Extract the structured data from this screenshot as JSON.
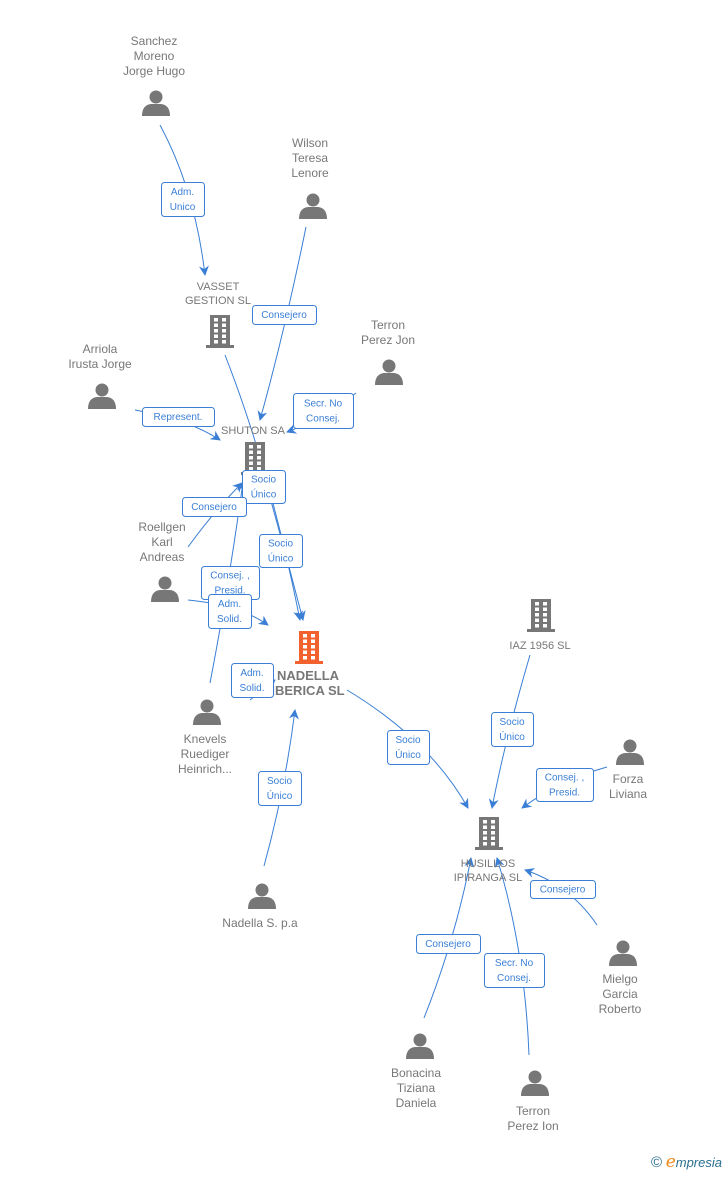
{
  "colors": {
    "edge": "#3a7fd5",
    "node": "#777777",
    "focus": "#f2622e"
  },
  "nodes": [
    {
      "id": "sanchez",
      "type": "person",
      "lines": [
        "Sanchez",
        "Moreno",
        "Jorge Hugo"
      ]
    },
    {
      "id": "wilson",
      "type": "person",
      "lines": [
        "Wilson",
        "Teresa",
        "Lenore"
      ]
    },
    {
      "id": "terronjon",
      "type": "person",
      "lines": [
        "Terron",
        "Perez Jon"
      ]
    },
    {
      "id": "arriola",
      "type": "person",
      "lines": [
        "Arriola",
        "Irusta Jorge"
      ]
    },
    {
      "id": "vasset",
      "type": "company",
      "lines": [
        "VASSET",
        "GESTION SL"
      ]
    },
    {
      "id": "shuton",
      "type": "company",
      "lines": [
        "SHUTON SA"
      ]
    },
    {
      "id": "roellgen",
      "type": "person",
      "lines": [
        "Roellgen",
        "Karl",
        "Andreas"
      ]
    },
    {
      "id": "nadella",
      "type": "company-focus",
      "lines": [
        "NADELLA",
        "IBERICA  SL"
      ]
    },
    {
      "id": "knevels",
      "type": "person",
      "lines": [
        "Knevels",
        "Ruediger",
        "Heinrich..."
      ]
    },
    {
      "id": "iaz",
      "type": "company",
      "lines": [
        "IAZ 1956  SL"
      ]
    },
    {
      "id": "forza",
      "type": "person",
      "lines": [
        "Forza",
        "Liviana"
      ]
    },
    {
      "id": "husillos",
      "type": "company",
      "lines": [
        "HUSILLOS",
        "IPIRANGA  SL"
      ]
    },
    {
      "id": "nadellaspa",
      "type": "person",
      "lines": [
        "Nadella S. p.a"
      ]
    },
    {
      "id": "mielgo",
      "type": "person",
      "lines": [
        "Mielgo",
        "Garcia",
        "Roberto"
      ]
    },
    {
      "id": "bonacina",
      "type": "person",
      "lines": [
        "Bonacina",
        "Tiziana",
        "Daniela"
      ]
    },
    {
      "id": "terronion",
      "type": "person",
      "lines": [
        "Terron",
        "Perez Ion"
      ]
    }
  ],
  "edges": [
    {
      "from": "sanchez",
      "to": "vasset",
      "label": [
        "Adm.",
        "Unico"
      ]
    },
    {
      "from": "wilson",
      "to": "shuton",
      "label": [
        "Consejero"
      ]
    },
    {
      "from": "terronjon",
      "to": "shuton",
      "label": [
        "Secr.  No",
        "Consej."
      ]
    },
    {
      "from": "arriola",
      "to": "shuton",
      "label": [
        "Represent."
      ]
    },
    {
      "from": "vasset",
      "to": "nadella",
      "label": [
        "Socio",
        "Único"
      ]
    },
    {
      "from": "shuton",
      "to": "nadella",
      "label": [
        "Socio",
        "Único"
      ]
    },
    {
      "from": "roellgen",
      "to": "shuton",
      "label": [
        "Consejero"
      ]
    },
    {
      "from": "knevels",
      "to": "shuton",
      "label": [
        "Consej. ,",
        "Presid."
      ]
    },
    {
      "from": "roellgen",
      "to": "nadella",
      "label": [
        "Adm.",
        "Solid."
      ]
    },
    {
      "from": "knevels",
      "to": "nadella",
      "label": [
        "Adm.",
        "Solid."
      ]
    },
    {
      "from": "nadellaspa",
      "to": "nadella",
      "label": [
        "Socio",
        "Único"
      ]
    },
    {
      "from": "nadella",
      "to": "husillos",
      "label": [
        "Socio",
        "Único"
      ]
    },
    {
      "from": "iaz",
      "to": "husillos",
      "label": [
        "Socio",
        "Único"
      ]
    },
    {
      "from": "forza",
      "to": "husillos",
      "label": [
        "Consej. ,",
        "Presid."
      ]
    },
    {
      "from": "mielgo",
      "to": "husillos",
      "label": [
        "Consejero"
      ]
    },
    {
      "from": "bonacina",
      "to": "husillos",
      "label": [
        "Consejero"
      ]
    },
    {
      "from": "terronion",
      "to": "husillos",
      "label": [
        "Secr.  No",
        "Consej."
      ]
    }
  ],
  "footer": {
    "copyright": "©",
    "brand_initial": "e",
    "brand_rest": "mpresia"
  }
}
